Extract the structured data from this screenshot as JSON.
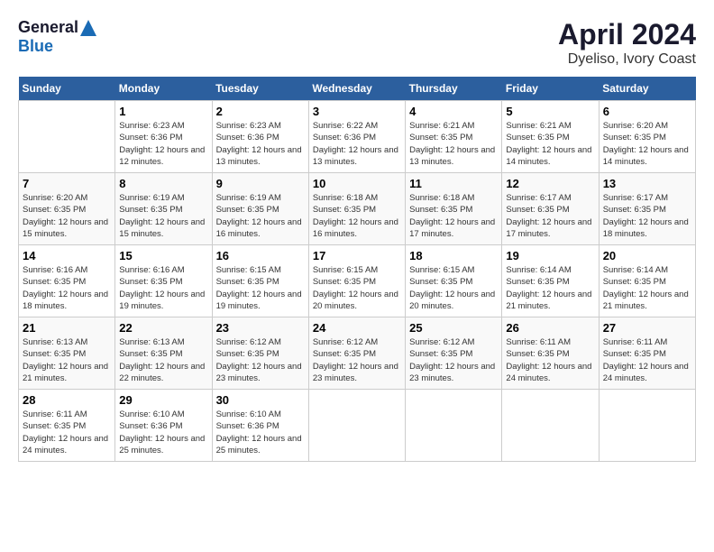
{
  "header": {
    "logo_general": "General",
    "logo_blue": "Blue",
    "title": "April 2024",
    "subtitle": "Dyeliso, Ivory Coast"
  },
  "calendar": {
    "columns": [
      "Sunday",
      "Monday",
      "Tuesday",
      "Wednesday",
      "Thursday",
      "Friday",
      "Saturday"
    ],
    "weeks": [
      [
        {
          "day": null
        },
        {
          "day": "1",
          "sunrise": "Sunrise: 6:23 AM",
          "sunset": "Sunset: 6:36 PM",
          "daylight": "Daylight: 12 hours and 12 minutes."
        },
        {
          "day": "2",
          "sunrise": "Sunrise: 6:23 AM",
          "sunset": "Sunset: 6:36 PM",
          "daylight": "Daylight: 12 hours and 13 minutes."
        },
        {
          "day": "3",
          "sunrise": "Sunrise: 6:22 AM",
          "sunset": "Sunset: 6:36 PM",
          "daylight": "Daylight: 12 hours and 13 minutes."
        },
        {
          "day": "4",
          "sunrise": "Sunrise: 6:21 AM",
          "sunset": "Sunset: 6:35 PM",
          "daylight": "Daylight: 12 hours and 13 minutes."
        },
        {
          "day": "5",
          "sunrise": "Sunrise: 6:21 AM",
          "sunset": "Sunset: 6:35 PM",
          "daylight": "Daylight: 12 hours and 14 minutes."
        },
        {
          "day": "6",
          "sunrise": "Sunrise: 6:20 AM",
          "sunset": "Sunset: 6:35 PM",
          "daylight": "Daylight: 12 hours and 14 minutes."
        }
      ],
      [
        {
          "day": "7",
          "sunrise": "Sunrise: 6:20 AM",
          "sunset": "Sunset: 6:35 PM",
          "daylight": "Daylight: 12 hours and 15 minutes."
        },
        {
          "day": "8",
          "sunrise": "Sunrise: 6:19 AM",
          "sunset": "Sunset: 6:35 PM",
          "daylight": "Daylight: 12 hours and 15 minutes."
        },
        {
          "day": "9",
          "sunrise": "Sunrise: 6:19 AM",
          "sunset": "Sunset: 6:35 PM",
          "daylight": "Daylight: 12 hours and 16 minutes."
        },
        {
          "day": "10",
          "sunrise": "Sunrise: 6:18 AM",
          "sunset": "Sunset: 6:35 PM",
          "daylight": "Daylight: 12 hours and 16 minutes."
        },
        {
          "day": "11",
          "sunrise": "Sunrise: 6:18 AM",
          "sunset": "Sunset: 6:35 PM",
          "daylight": "Daylight: 12 hours and 17 minutes."
        },
        {
          "day": "12",
          "sunrise": "Sunrise: 6:17 AM",
          "sunset": "Sunset: 6:35 PM",
          "daylight": "Daylight: 12 hours and 17 minutes."
        },
        {
          "day": "13",
          "sunrise": "Sunrise: 6:17 AM",
          "sunset": "Sunset: 6:35 PM",
          "daylight": "Daylight: 12 hours and 18 minutes."
        }
      ],
      [
        {
          "day": "14",
          "sunrise": "Sunrise: 6:16 AM",
          "sunset": "Sunset: 6:35 PM",
          "daylight": "Daylight: 12 hours and 18 minutes."
        },
        {
          "day": "15",
          "sunrise": "Sunrise: 6:16 AM",
          "sunset": "Sunset: 6:35 PM",
          "daylight": "Daylight: 12 hours and 19 minutes."
        },
        {
          "day": "16",
          "sunrise": "Sunrise: 6:15 AM",
          "sunset": "Sunset: 6:35 PM",
          "daylight": "Daylight: 12 hours and 19 minutes."
        },
        {
          "day": "17",
          "sunrise": "Sunrise: 6:15 AM",
          "sunset": "Sunset: 6:35 PM",
          "daylight": "Daylight: 12 hours and 20 minutes."
        },
        {
          "day": "18",
          "sunrise": "Sunrise: 6:15 AM",
          "sunset": "Sunset: 6:35 PM",
          "daylight": "Daylight: 12 hours and 20 minutes."
        },
        {
          "day": "19",
          "sunrise": "Sunrise: 6:14 AM",
          "sunset": "Sunset: 6:35 PM",
          "daylight": "Daylight: 12 hours and 21 minutes."
        },
        {
          "day": "20",
          "sunrise": "Sunrise: 6:14 AM",
          "sunset": "Sunset: 6:35 PM",
          "daylight": "Daylight: 12 hours and 21 minutes."
        }
      ],
      [
        {
          "day": "21",
          "sunrise": "Sunrise: 6:13 AM",
          "sunset": "Sunset: 6:35 PM",
          "daylight": "Daylight: 12 hours and 21 minutes."
        },
        {
          "day": "22",
          "sunrise": "Sunrise: 6:13 AM",
          "sunset": "Sunset: 6:35 PM",
          "daylight": "Daylight: 12 hours and 22 minutes."
        },
        {
          "day": "23",
          "sunrise": "Sunrise: 6:12 AM",
          "sunset": "Sunset: 6:35 PM",
          "daylight": "Daylight: 12 hours and 23 minutes."
        },
        {
          "day": "24",
          "sunrise": "Sunrise: 6:12 AM",
          "sunset": "Sunset: 6:35 PM",
          "daylight": "Daylight: 12 hours and 23 minutes."
        },
        {
          "day": "25",
          "sunrise": "Sunrise: 6:12 AM",
          "sunset": "Sunset: 6:35 PM",
          "daylight": "Daylight: 12 hours and 23 minutes."
        },
        {
          "day": "26",
          "sunrise": "Sunrise: 6:11 AM",
          "sunset": "Sunset: 6:35 PM",
          "daylight": "Daylight: 12 hours and 24 minutes."
        },
        {
          "day": "27",
          "sunrise": "Sunrise: 6:11 AM",
          "sunset": "Sunset: 6:35 PM",
          "daylight": "Daylight: 12 hours and 24 minutes."
        }
      ],
      [
        {
          "day": "28",
          "sunrise": "Sunrise: 6:11 AM",
          "sunset": "Sunset: 6:35 PM",
          "daylight": "Daylight: 12 hours and 24 minutes."
        },
        {
          "day": "29",
          "sunrise": "Sunrise: 6:10 AM",
          "sunset": "Sunset: 6:36 PM",
          "daylight": "Daylight: 12 hours and 25 minutes."
        },
        {
          "day": "30",
          "sunrise": "Sunrise: 6:10 AM",
          "sunset": "Sunset: 6:36 PM",
          "daylight": "Daylight: 12 hours and 25 minutes."
        },
        {
          "day": null
        },
        {
          "day": null
        },
        {
          "day": null
        },
        {
          "day": null
        }
      ]
    ]
  }
}
